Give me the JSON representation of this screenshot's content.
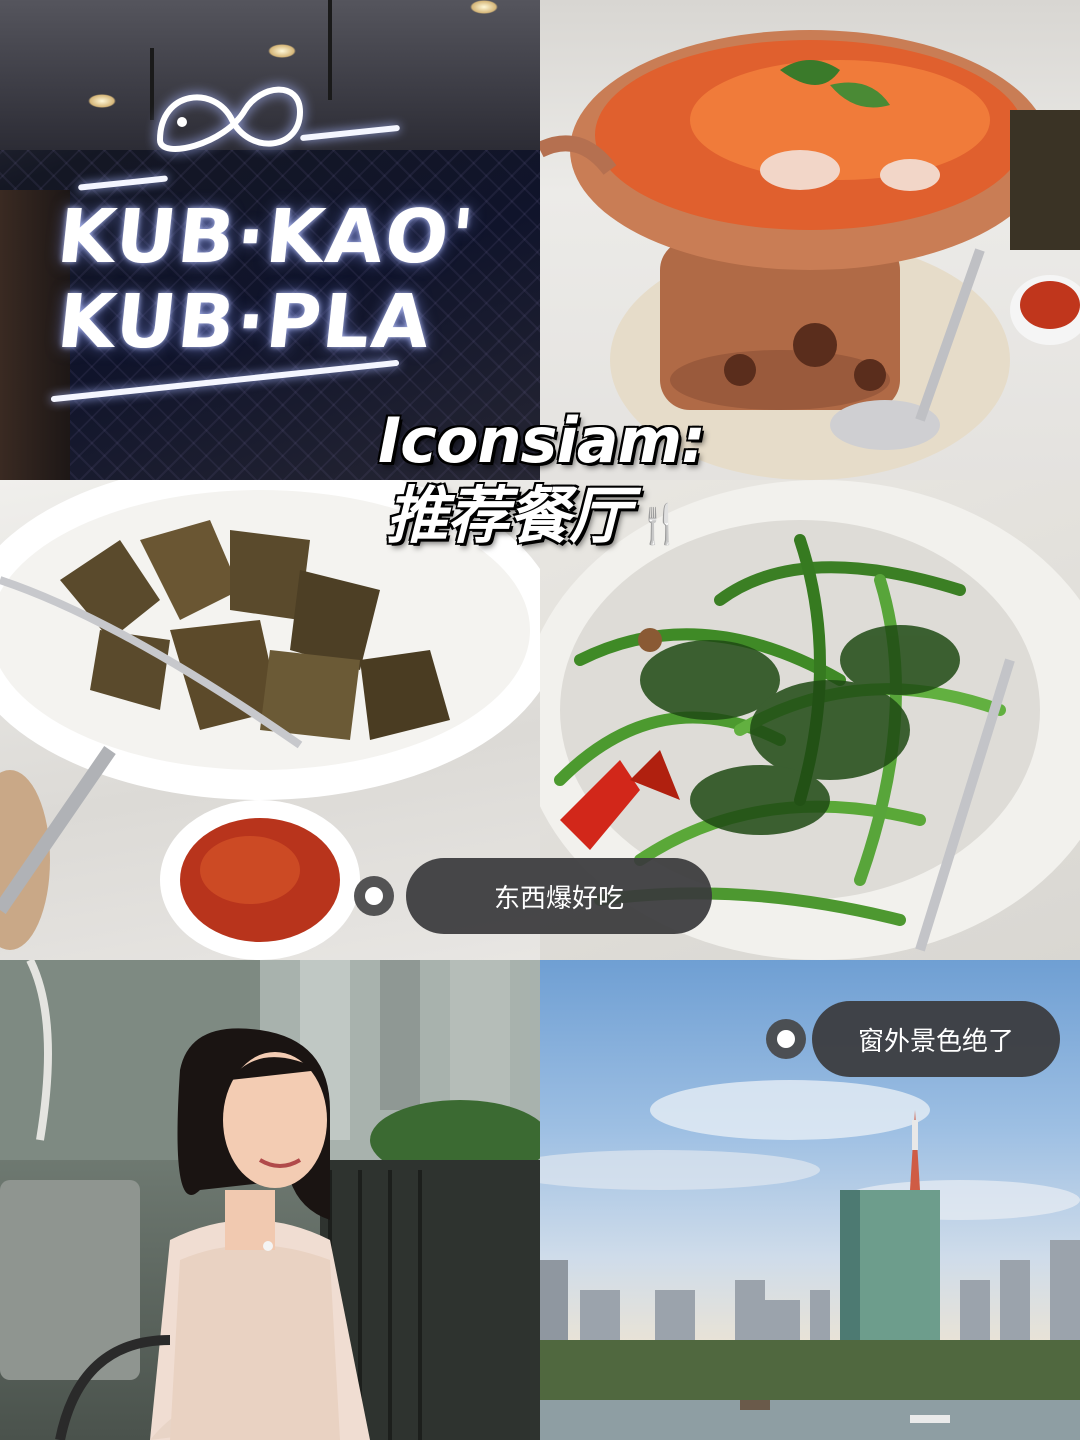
{
  "title": {
    "line1": "Iconsiam:",
    "line2": "推荐餐厅",
    "cutlery": "🍴"
  },
  "sign": {
    "line1": "KUB·KAO'",
    "line2": "KUB·PLA"
  },
  "tags": {
    "food": "东西爆好吃",
    "view": "窗外景色绝了"
  },
  "photos": {
    "restaurant_sign": "restaurant-sign",
    "tom_yum": "tom-yum-hot-pot",
    "pandan_chicken": "pandan-chicken",
    "morning_glory": "stir-fried-morning-glory",
    "portrait": "portrait",
    "skyline": "bangkok-skyline"
  },
  "colors": {
    "tag_bg": "#3a3a3c",
    "neon": "#ffffff"
  }
}
